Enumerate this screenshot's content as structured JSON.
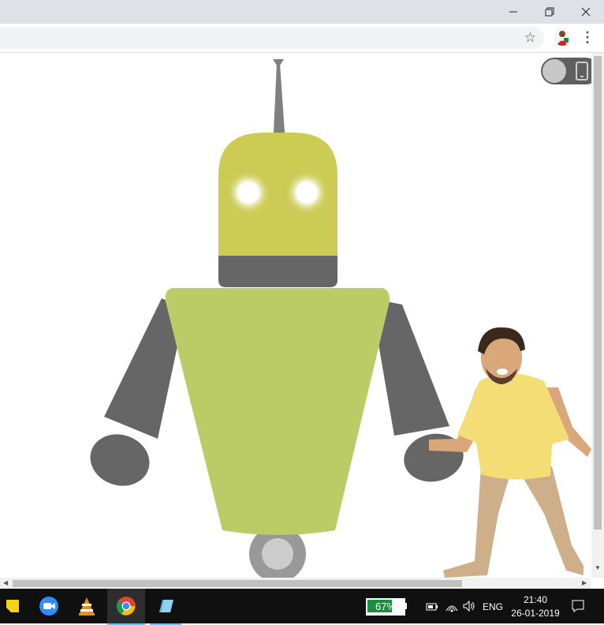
{
  "window": {
    "minimize_icon": "minimize-icon",
    "restore_icon": "restore-icon",
    "close_icon": "close-icon"
  },
  "toolbar": {
    "address_value": "",
    "bookmark_icon": "star-icon",
    "profile_icon": "avatar",
    "menu_icon": "kebab-menu-icon"
  },
  "page": {
    "toggle": {
      "state": "off",
      "icon": "phone-icon"
    },
    "robot": {
      "antenna_color": "#808080",
      "head_color": "#cccc55",
      "eye_color": "#ffffff",
      "jaw_color": "#666666",
      "body_color": "#bbcc66",
      "arm_color": "#666666",
      "wheel_color": "#999999"
    },
    "dancer": "dancing-man-image"
  },
  "taskbar": {
    "apps": [
      "sticky-notes-icon",
      "zoom-icon",
      "vlc-icon",
      "chrome-icon",
      "notes-app-icon"
    ],
    "battery_percent": "67%",
    "battery_level": 0.67,
    "language": "ENG",
    "time": "21:40",
    "date": "26-01-2019"
  }
}
